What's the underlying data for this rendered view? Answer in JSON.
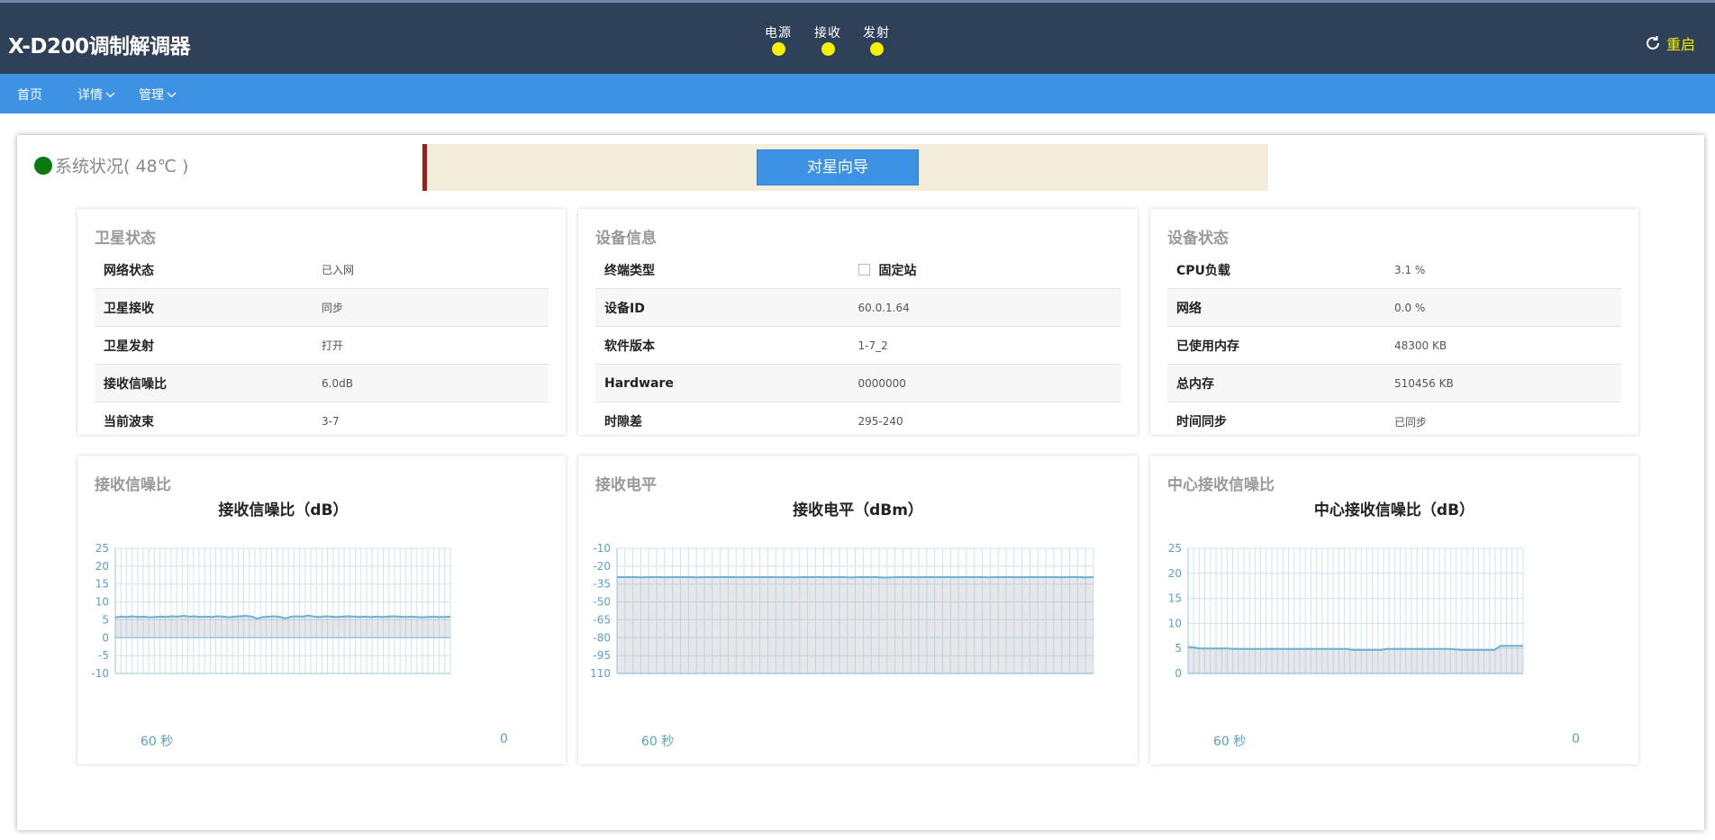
{
  "header": {
    "app_title": "X-D200调制解调器",
    "indicators": [
      {
        "label": "电源",
        "color": "#f5ef00"
      },
      {
        "label": "接收",
        "color": "#f5ef00"
      },
      {
        "label": "发射",
        "color": "#f5ef00"
      }
    ],
    "restart_label": "重启"
  },
  "nav": {
    "home": "首页",
    "details": "详情",
    "manage": "管理"
  },
  "system": {
    "status_text": "系统状况( 48℃ )",
    "status_color": "#0a7a10"
  },
  "wizard": {
    "button_label": "对星向导"
  },
  "satellite_status": {
    "title": "卫星状态",
    "rows": [
      {
        "key": "网络状态",
        "value": "已入网"
      },
      {
        "key": "卫星接收",
        "value": "同步"
      },
      {
        "key": "卫星发射",
        "value": "打开"
      },
      {
        "key": "接收信噪比",
        "value": "6.0dB"
      },
      {
        "key": "当前波束",
        "value": "3-7"
      }
    ]
  },
  "device_info": {
    "title": "设备信息",
    "terminal_type_key": "终端类型",
    "terminal_type_value": "固定站",
    "rows": [
      {
        "key": "设备ID",
        "value": "60.0.1.64"
      },
      {
        "key": "软件版本",
        "value": "1-7_2"
      },
      {
        "key": "Hardware",
        "value": "0000000"
      },
      {
        "key": "时隙差",
        "value": "295-240"
      }
    ]
  },
  "device_status": {
    "title": "设备状态",
    "rows": [
      {
        "key": "CPU负载",
        "value": "3.1 %"
      },
      {
        "key": "网络",
        "value": "0.0 %"
      },
      {
        "key": "已使用内存",
        "value": "48300 KB"
      },
      {
        "key": "总内存",
        "value": "510456 KB"
      },
      {
        "key": "时间同步",
        "value": "已同步"
      }
    ]
  },
  "chart_data": [
    {
      "type": "area",
      "panel_title": "接收信噪比",
      "title": "接收信噪比（dB）",
      "x_left_label": "60 秒",
      "x_right_label": "0",
      "yticks": [
        25,
        20,
        15,
        10,
        5,
        0,
        -5,
        -10
      ],
      "ylim": [
        -10,
        25
      ],
      "baseline": 0,
      "values": [
        5.7,
        5.9,
        5.8,
        6.0,
        5.8,
        5.9,
        5.7,
        5.8,
        5.9,
        5.8,
        6.0,
        5.9,
        6.1,
        5.9,
        6.0,
        5.8,
        5.9,
        5.8,
        6.0,
        5.9,
        5.7,
        5.9,
        6.0,
        6.1,
        5.9,
        5.3,
        5.8,
        5.9,
        6.0,
        5.8,
        5.4,
        5.9,
        6.0,
        5.9,
        6.2,
        5.9,
        5.8,
        6.0,
        5.9,
        5.8,
        5.9,
        6.0,
        5.9,
        5.8,
        5.9,
        5.8,
        5.9,
        5.8,
        5.9,
        6.0,
        5.9,
        5.8,
        5.9,
        5.8,
        5.7,
        5.8,
        5.9,
        5.8,
        5.8,
        5.9
      ],
      "grid": true
    },
    {
      "type": "area",
      "panel_title": "接收电平",
      "title": "接收电平（dBm）",
      "x_left_label": "60 秒",
      "x_right_label": "",
      "yticks": [
        -10,
        -20,
        -35,
        -50,
        -65,
        -80,
        -95,
        110
      ],
      "ylim": [
        -110,
        -10
      ],
      "baseline": -110,
      "values": [
        -33,
        -33,
        -33,
        -33.2,
        -33,
        -33,
        -33.1,
        -33,
        -33,
        -33,
        -33.2,
        -33,
        -33,
        -32.9,
        -33,
        -33.1,
        -33,
        -33,
        -33,
        -33,
        -33.1,
        -33,
        -33.2,
        -33,
        -33,
        -33,
        -33.1,
        -33,
        -33,
        -33.3,
        -33,
        -33,
        -33,
        -33.4,
        -33.2,
        -33,
        -33,
        -33.1,
        -33,
        -33,
        -33,
        -33,
        -33.1,
        -33,
        -33,
        -33,
        -33.2,
        -33,
        -33,
        -33,
        -33.1,
        -33,
        -33,
        -33,
        -33,
        -33.1,
        -33,
        -33,
        -33.2,
        -33
      ],
      "grid": true
    },
    {
      "type": "area",
      "panel_title": "中心接收信噪比",
      "title": "中心接收信噪比（dB）",
      "x_left_label": "60 秒",
      "x_right_label": "0",
      "yticks": [
        25,
        20,
        15,
        10,
        5,
        0
      ],
      "ylim": [
        0,
        25
      ],
      "baseline": 0,
      "values": [
        5.3,
        5.2,
        5.0,
        5.0,
        5.0,
        5.0,
        5.0,
        5.0,
        4.9,
        4.9,
        4.9,
        4.9,
        4.9,
        4.9,
        4.9,
        4.9,
        4.9,
        4.9,
        4.9,
        4.9,
        4.9,
        4.9,
        4.9,
        4.9,
        4.9,
        4.9,
        4.9,
        4.9,
        4.9,
        4.7,
        4.7,
        4.7,
        4.7,
        4.7,
        4.7,
        4.9,
        4.9,
        4.9,
        4.9,
        4.9,
        4.9,
        4.9,
        4.9,
        4.9,
        4.9,
        4.9,
        4.9,
        4.8,
        4.7,
        4.7,
        4.7,
        4.7,
        4.7,
        4.7,
        4.7,
        5.5,
        5.5,
        5.5,
        5.5,
        5.5
      ],
      "grid": true
    }
  ]
}
